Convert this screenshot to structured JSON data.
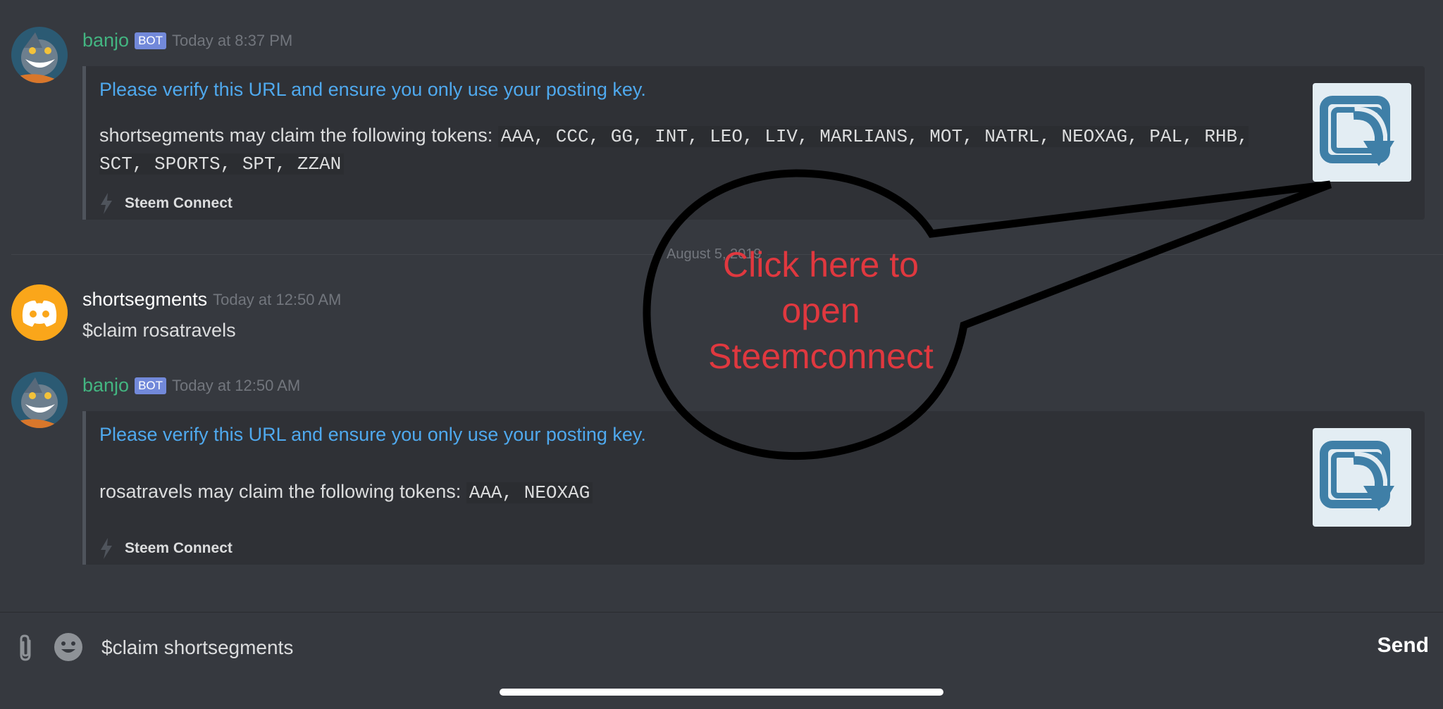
{
  "messages": [
    {
      "username": "banjo",
      "bot_tag": "BOT",
      "timestamp": "Today at 8:37 PM",
      "embed": {
        "title": "Please verify this URL and ensure you only use your posting key.",
        "description_prefix": "shortsegments may claim the following tokens: ",
        "tokens": "AAA, CCC, GG, INT, LEO, LIV, MARLIANS, MOT, NATRL, NEOXAG, PAL, RHB, SCT, SPORTS, SPT, ZZAN",
        "footer": "Steem Connect"
      }
    },
    {
      "username": "shortsegments",
      "timestamp": "Today at 12:50 AM",
      "text": "$claim rosatravels"
    },
    {
      "username": "banjo",
      "bot_tag": "BOT",
      "timestamp": "Today at 12:50 AM",
      "embed": {
        "title": "Please verify this URL and ensure you only use your posting key.",
        "description_prefix": "rosatravels may claim the following tokens: ",
        "tokens": "AAA, NEOXAG",
        "footer": "Steem Connect"
      }
    }
  ],
  "divider_date": "August 5, 2019",
  "annotation": {
    "lines": [
      "Click here to",
      "open",
      "Steemconnect"
    ],
    "color": "#e0383f"
  },
  "input": {
    "value": "$claim shortsegments",
    "send_label": "Send"
  },
  "colors": {
    "background": "#36393f",
    "embed_bg": "#2f3136",
    "bot_name": "#43b581",
    "link": "#4fa9ee",
    "bot_tag": "#7289da",
    "discord_avatar": "#faa61a"
  },
  "icons": [
    "banjo-avatar",
    "discord-default-avatar",
    "steemconnect-thumbnail-icon",
    "lightning-bolt-icon",
    "paperclip-icon",
    "emoji-icon"
  ]
}
